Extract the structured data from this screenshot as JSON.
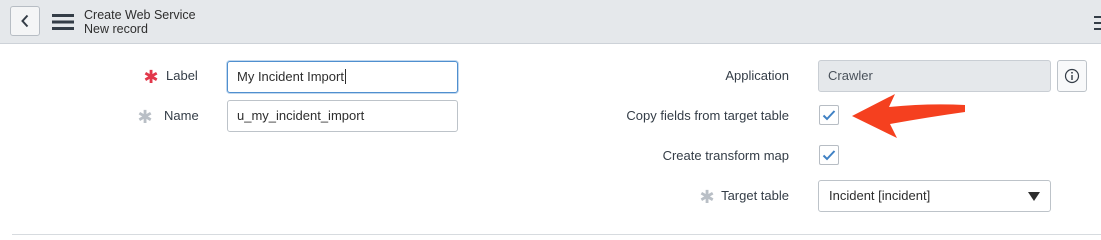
{
  "header": {
    "title": "Create Web Service",
    "subtitle": "New record",
    "icons": {
      "back": "chevron-left-icon",
      "menu": "hamburger-menu-icon",
      "more": "more-options-icon"
    }
  },
  "form": {
    "label_field": {
      "label": "Label",
      "value": "My Incident Import",
      "required": true,
      "required_filled": false
    },
    "name_field": {
      "label": "Name",
      "value": "u_my_incident_import",
      "required": true,
      "required_filled": true
    },
    "application_field": {
      "label": "Application",
      "value": "Crawler",
      "read_only": true
    },
    "copy_fields": {
      "label": "Copy fields from target table",
      "checked": true
    },
    "create_transform_map": {
      "label": "Create transform map",
      "checked": true
    },
    "target_table": {
      "label": "Target table",
      "value": "Incident [incident]",
      "required": true
    }
  },
  "colors": {
    "accent": "#4f8fcf",
    "required_mark": "#e2374a",
    "annotation_arrow": "#f5401f",
    "header_bg": "#e5e8eb"
  }
}
